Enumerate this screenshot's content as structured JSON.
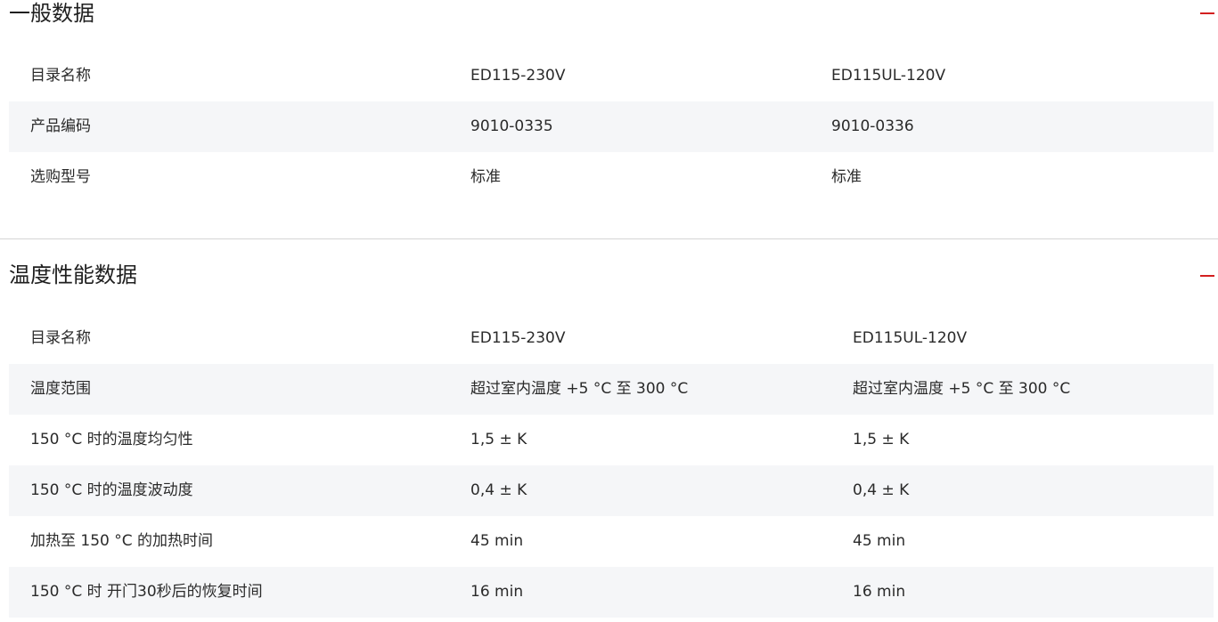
{
  "colors": {
    "accent": "#d31f1f",
    "row_shade": "#f5f6f8",
    "divider": "#d5d5d5"
  },
  "sections": [
    {
      "title": "一般数据",
      "collapse_icon": "minus-icon",
      "rows": [
        [
          "目录名称",
          "ED115-230V",
          "ED115UL-120V"
        ],
        [
          "产品编码",
          "9010-0335",
          "9010-0336"
        ],
        [
          "选购型号",
          "标准",
          "标准"
        ]
      ]
    },
    {
      "title": "温度性能数据",
      "collapse_icon": "minus-icon",
      "rows": [
        [
          "目录名称",
          "ED115-230V",
          "ED115UL-120V"
        ],
        [
          "温度范围",
          "超过室内温度 +5 °C 至 300 °C",
          "超过室内温度 +5 °C 至 300 °C"
        ],
        [
          "150 °C 时的温度均匀性",
          "1,5 ± K",
          "1,5 ± K"
        ],
        [
          "150 °C 时的温度波动度",
          "0,4 ± K",
          "0,4 ± K"
        ],
        [
          "加热至 150 °C 的加热时间",
          "45 min",
          "45 min"
        ],
        [
          "150 °C 时 开门30秒后的恢复时间",
          "16 min",
          "16 min"
        ]
      ]
    }
  ]
}
